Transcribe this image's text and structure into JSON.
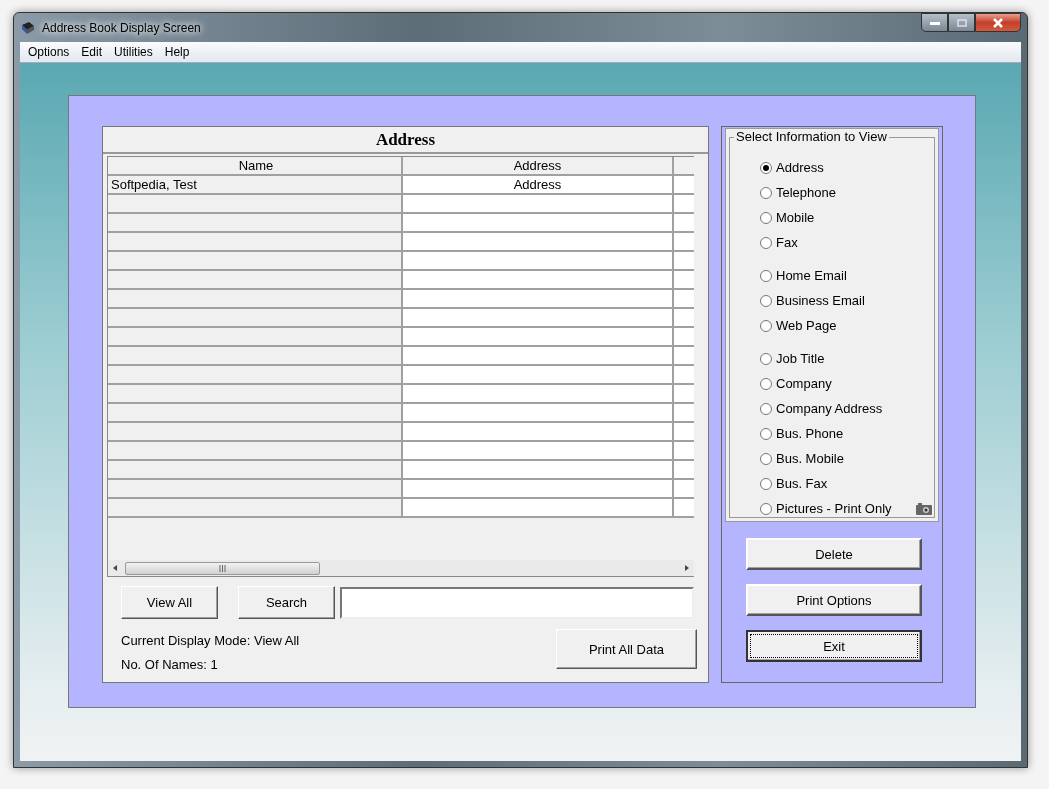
{
  "window": {
    "title": "Address Book Display Screen"
  },
  "menu": [
    "Options",
    "Edit",
    "Utilities",
    "Help"
  ],
  "table": {
    "title": "Address",
    "columns": [
      "Name",
      "Address"
    ],
    "rows": [
      {
        "name": "Softpedia, Test",
        "address": "Address"
      }
    ]
  },
  "actions": {
    "view_all": "View All",
    "search": "Search",
    "print_all": "Print All Data"
  },
  "status": {
    "mode": "Current Display Mode: View All",
    "count": "No. Of Names: 1"
  },
  "view_options": {
    "title": "Select Information to View",
    "groups": [
      [
        {
          "label": "Address",
          "selected": true,
          "kind": "plain"
        },
        {
          "label": "Telephone",
          "selected": false,
          "kind": "plain"
        },
        {
          "label": "Mobile",
          "selected": false,
          "kind": "plain"
        },
        {
          "label": "Fax",
          "selected": false,
          "kind": "plain"
        }
      ],
      [
        {
          "label": "Home Email",
          "selected": false,
          "kind": "plain"
        },
        {
          "label": "Business Email",
          "selected": false,
          "kind": "plain"
        },
        {
          "label": "Web Page",
          "selected": false,
          "kind": "plain"
        }
      ],
      [
        {
          "label": "Job Title",
          "selected": false,
          "kind": "plain"
        },
        {
          "label": "Company",
          "selected": false,
          "kind": "plain"
        },
        {
          "label": "Company Address",
          "selected": false,
          "kind": "plain"
        },
        {
          "label": "Bus. Phone",
          "selected": false,
          "kind": "plain"
        },
        {
          "label": "Bus. Mobile",
          "selected": false,
          "kind": "plain"
        },
        {
          "label": "Bus. Fax",
          "selected": false,
          "kind": "plain"
        },
        {
          "label": "Pictures - Print Only",
          "selected": false,
          "kind": "picture"
        }
      ]
    ]
  },
  "side_buttons": [
    {
      "label": "Delete",
      "focused": false
    },
    {
      "label": "Print Options",
      "focused": false
    },
    {
      "label": "Exit",
      "focused": true
    }
  ]
}
